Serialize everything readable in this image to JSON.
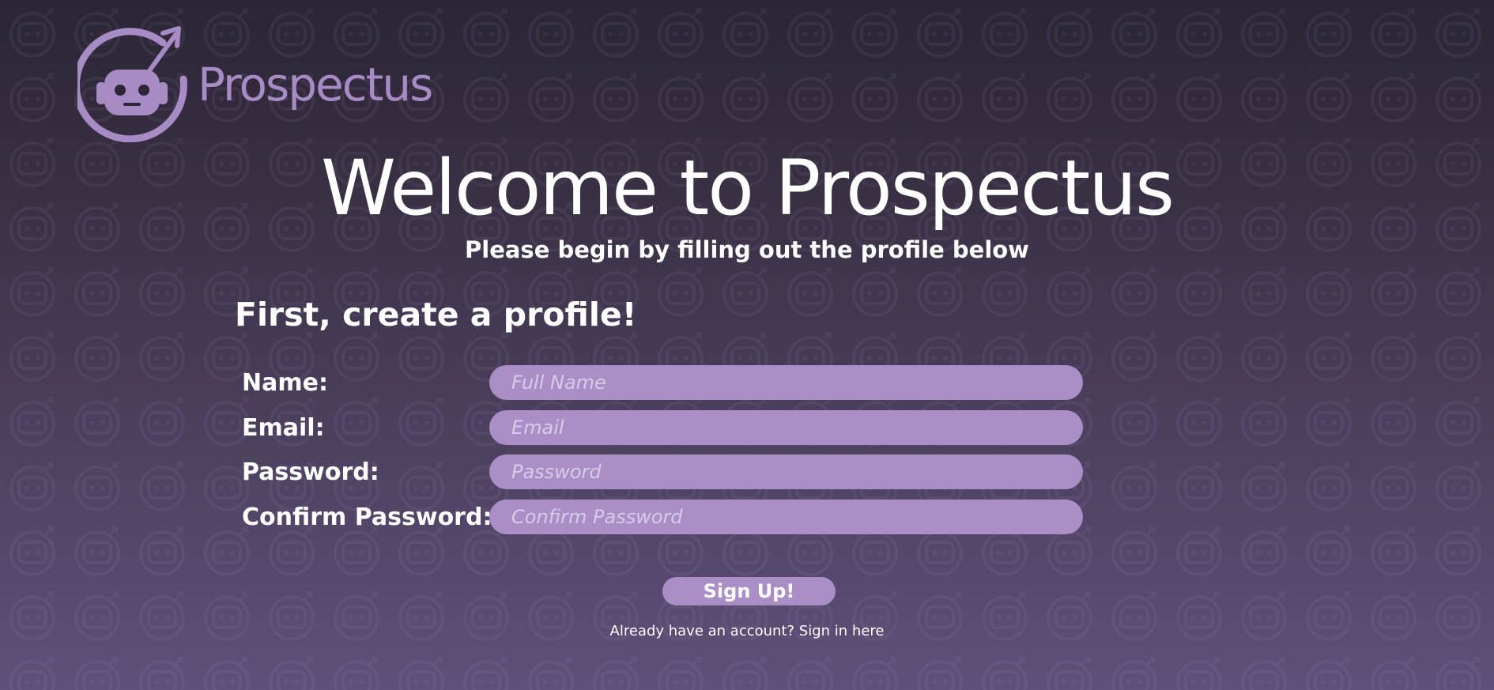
{
  "brand": {
    "name": "Prospectus",
    "logo_icon": "robot-growth-arrow-icon",
    "accent_color": "#a98fc6",
    "logo_color": "#a78bc5"
  },
  "header": {
    "title": "Welcome to Prospectus",
    "subtitle": "Please begin by filling out the profile below"
  },
  "form": {
    "section_title": "First, create a profile!",
    "fields": {
      "name": {
        "label": "Name:",
        "placeholder": "Full Name",
        "value": ""
      },
      "email": {
        "label": "Email:",
        "placeholder": "Email",
        "value": ""
      },
      "password": {
        "label": "Password:",
        "placeholder": "Password",
        "value": ""
      },
      "confirm_password": {
        "label": "Confirm Password:",
        "placeholder": "Confirm Password",
        "value": ""
      }
    },
    "submit_label": "Sign Up!"
  },
  "signin": {
    "prompt": "Already have an account?",
    "link_label": "Sign in here"
  },
  "background": {
    "pattern_icon": "robot-icon",
    "gradient_top": "#2b2535",
    "gradient_bottom": "#5f5079"
  }
}
